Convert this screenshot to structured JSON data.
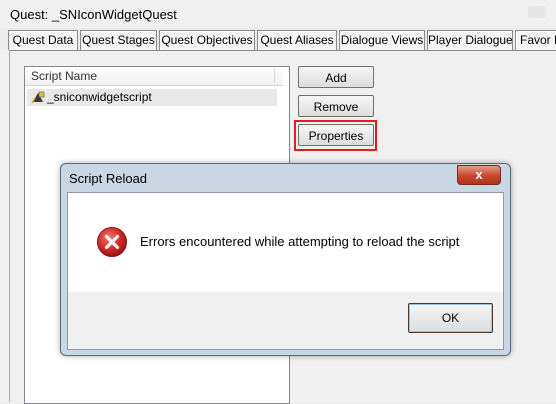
{
  "window": {
    "title": "Quest: _SNIconWidgetQuest"
  },
  "tabs": [
    {
      "label": "Quest Data"
    },
    {
      "label": "Quest Stages"
    },
    {
      "label": "Quest Objectives"
    },
    {
      "label": "Quest Aliases"
    },
    {
      "label": "Dialogue Views"
    },
    {
      "label": "Player Dialogue"
    },
    {
      "label": "Favor D"
    }
  ],
  "scripts": {
    "column_header": "Script Name",
    "rows": [
      {
        "name": "_sniconwidgetscript",
        "icon": "script-icon"
      }
    ]
  },
  "buttons": {
    "add": "Add",
    "remove": "Remove",
    "properties": "Properties"
  },
  "dialog": {
    "title": "Script Reload",
    "close_glyph": "x",
    "icon": "error-icon",
    "message": "Errors encountered while attempting to reload the script",
    "ok": "OK"
  },
  "colors": {
    "highlight": "#e02020",
    "error": "#d42a2a"
  }
}
